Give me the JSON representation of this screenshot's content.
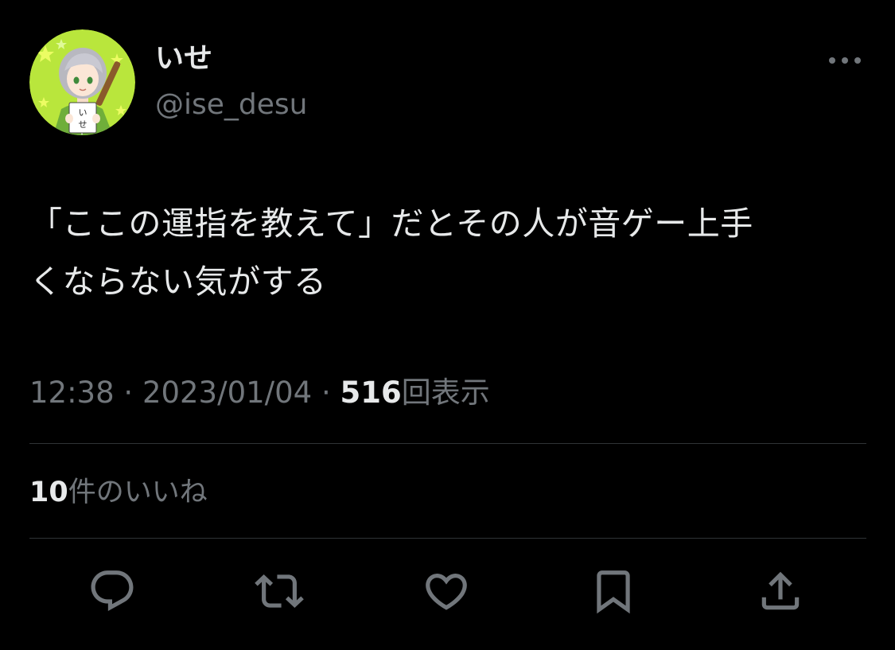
{
  "user": {
    "display_name": "いせ",
    "handle": "@ise_desu",
    "avatar_sign_text": "いせ"
  },
  "tweet": {
    "text_line_1": "「ここの運指を教えて」だとその人が音ゲー上手",
    "text_line_2": "くならない気がする",
    "time": "12:38",
    "sep_1": "·",
    "date": "2023/01/04",
    "sep_2": "·",
    "views_count": "516",
    "views_label": "回表示",
    "likes_count": "10",
    "likes_label": "件のいいね"
  },
  "icons": {
    "more": "more-horizontal-icon",
    "reply": "reply-icon",
    "retweet": "retweet-icon",
    "like": "heart-icon",
    "bookmark": "bookmark-icon",
    "share": "share-icon"
  },
  "colors": {
    "background": "#000000",
    "text_primary": "#e7e9ea",
    "text_secondary": "#71767b",
    "divider": "#2f3336",
    "icon": "#71767b",
    "avatar_bg": "#b9e63c"
  }
}
